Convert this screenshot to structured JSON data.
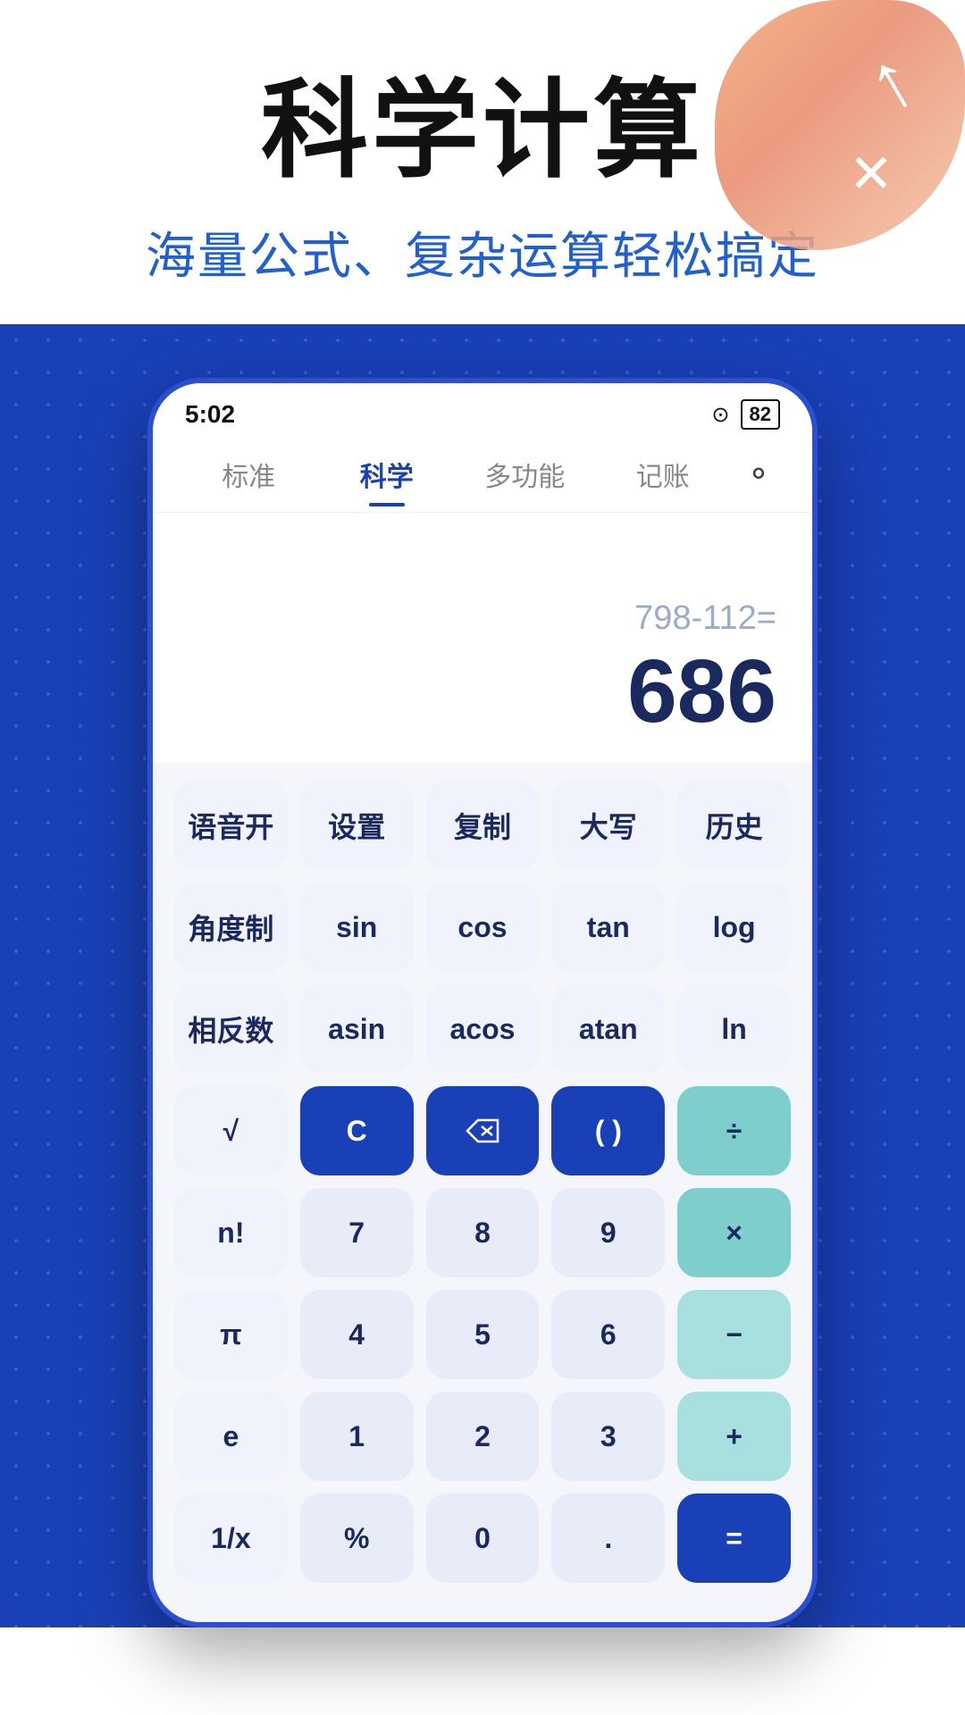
{
  "header": {
    "main_title": "科学计算",
    "subtitle": "海量公式、复杂运算轻松搞定"
  },
  "status_bar": {
    "time": "5:02",
    "battery": "82"
  },
  "nav": {
    "tabs": [
      "标准",
      "科学",
      "多功能",
      "记账"
    ],
    "active_tab": 1
  },
  "display": {
    "expression": "798-112=",
    "result": "686"
  },
  "keypad": {
    "row0": [
      "语音开",
      "设置",
      "复制",
      "大写",
      "历史"
    ],
    "row1": [
      "角度制",
      "sin",
      "cos",
      "tan",
      "log"
    ],
    "row2": [
      "相反数",
      "asin",
      "acos",
      "atan",
      "ln"
    ],
    "row3": [
      "√",
      "C",
      "⌫",
      "( )",
      "÷"
    ],
    "row4": [
      "n!",
      "7",
      "8",
      "9",
      "×"
    ],
    "row5": [
      "π",
      "4",
      "5",
      "6",
      "−"
    ],
    "row6": [
      "e",
      "1",
      "2",
      "3",
      "+"
    ],
    "row7": [
      "1/x",
      "%",
      "0",
      ".",
      "="
    ]
  }
}
